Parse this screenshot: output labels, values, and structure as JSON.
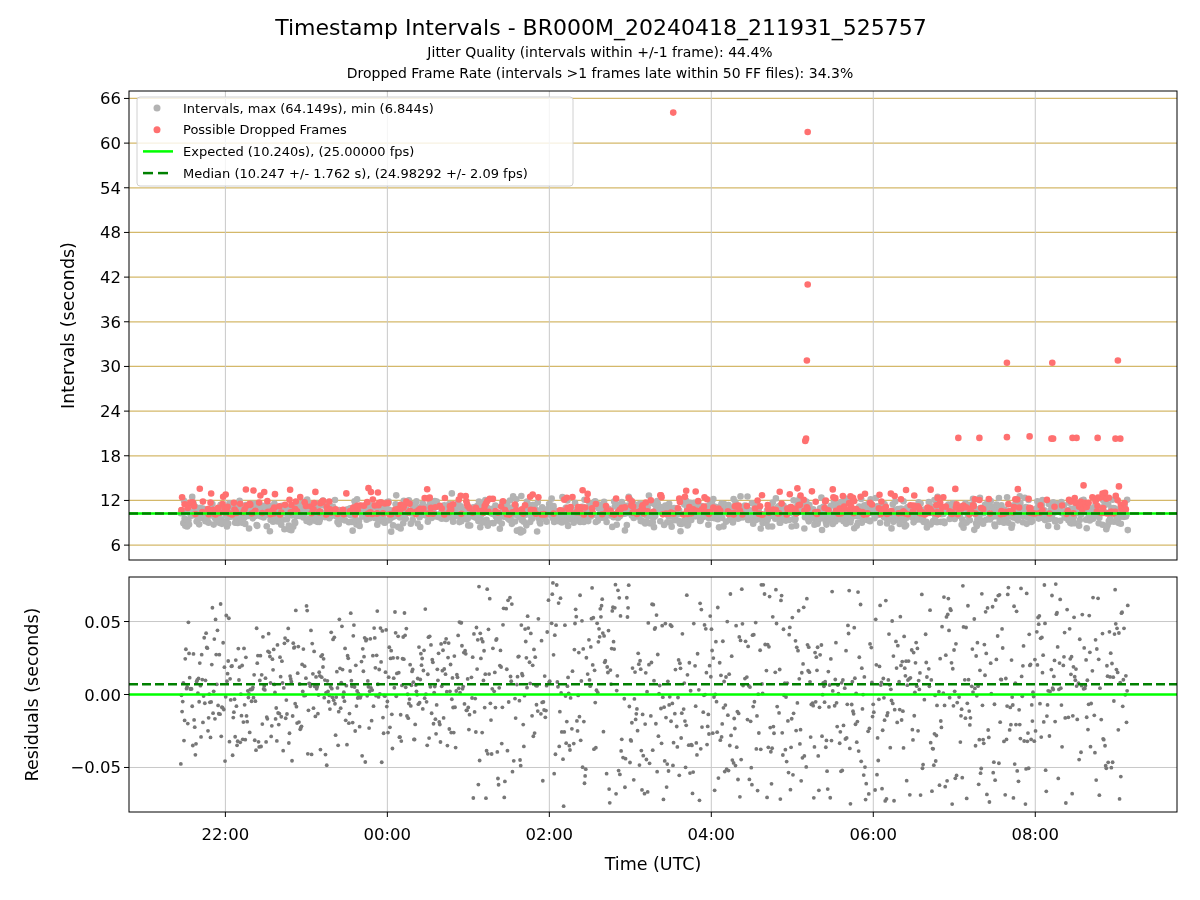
{
  "figure": {
    "title": "Timestamp Intervals - BR000M_20240418_211931_525757",
    "subtitles": [
      "Jitter Quality (intervals within +/-1 frame): 44.4%",
      "Dropped Frame Rate (intervals >1 frames late within 50 FF files): 34.3%"
    ]
  },
  "intervals_plot": {
    "legend": [
      {
        "label": "Intervals, max (64.149s), min (6.844s)",
        "kind": "marker",
        "color": "#b3b3b3"
      },
      {
        "label": "Possible Dropped Frames",
        "kind": "marker",
        "color": "#ff7070"
      },
      {
        "label": "Expected (10.240s), (25.00000 fps)",
        "kind": "line",
        "color": "#00ff00"
      },
      {
        "label": "Median (10.247 +/- 1.762 s), (24.98292 +/- 2.09 fps)",
        "kind": "dashed",
        "color": "#008000"
      }
    ],
    "ylabel": "Intervals (seconds)",
    "y_tick_labels": [
      "66",
      "60",
      "54",
      "48",
      "42",
      "36",
      "30",
      "24",
      "18",
      "12",
      "6"
    ]
  },
  "residuals_plot": {
    "ylabel": "Residuals (seconds)",
    "y_tick_labels": [
      "0.05",
      "0.00",
      "−0.05"
    ],
    "x_tick_labels": [
      "22:00",
      "00:00",
      "02:00",
      "04:00",
      "06:00",
      "08:00"
    ],
    "xlabel": "Time (UTC)"
  }
}
